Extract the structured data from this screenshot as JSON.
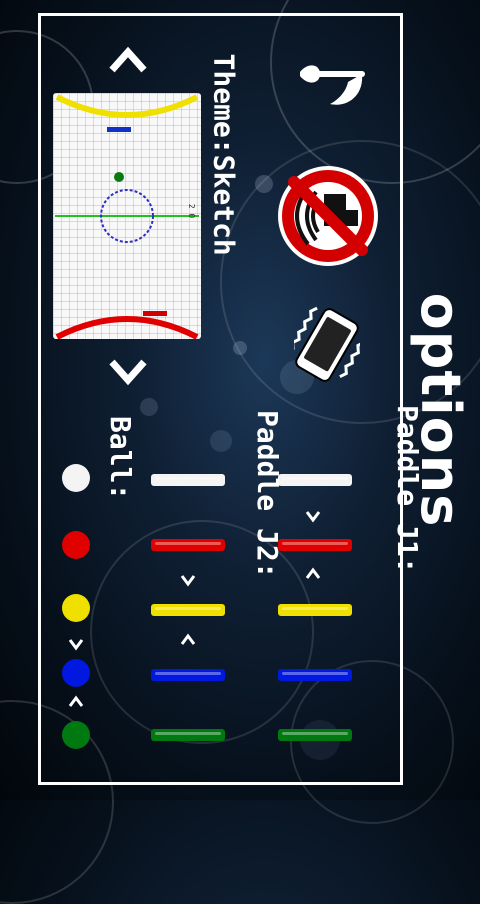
{
  "screen": {
    "title": "options",
    "theme_label": "Theme:Sketch",
    "paddle_j1_label": "Paddle J1:",
    "paddle_j2_label": "Paddle J2:",
    "ball_label": "Ball:"
  },
  "icons": {
    "sound": "music-note-icon",
    "touch_vibration": "no-touch-vibration-icon",
    "vibration": "vibrating-phone-icon"
  },
  "colors": {
    "white": "#f4f4f4",
    "red": "#e00000",
    "yellow": "#f0e000",
    "blue": "#0018e0",
    "green": "#007a10"
  },
  "preview": {
    "score": "2 0",
    "top_goal_color": "#f0e000",
    "bottom_goal_color": "#e00000",
    "top_paddle_color": "#1030c8",
    "bottom_paddle_color": "#d00000",
    "puck_color": "#0a7a10",
    "center_color": "#3030c0",
    "midline_color": "#20c020"
  },
  "paddle_colors_order": [
    "white",
    "red",
    "yellow",
    "blue",
    "green"
  ],
  "ball_colors_order": [
    "white",
    "red",
    "yellow",
    "blue",
    "green"
  ]
}
